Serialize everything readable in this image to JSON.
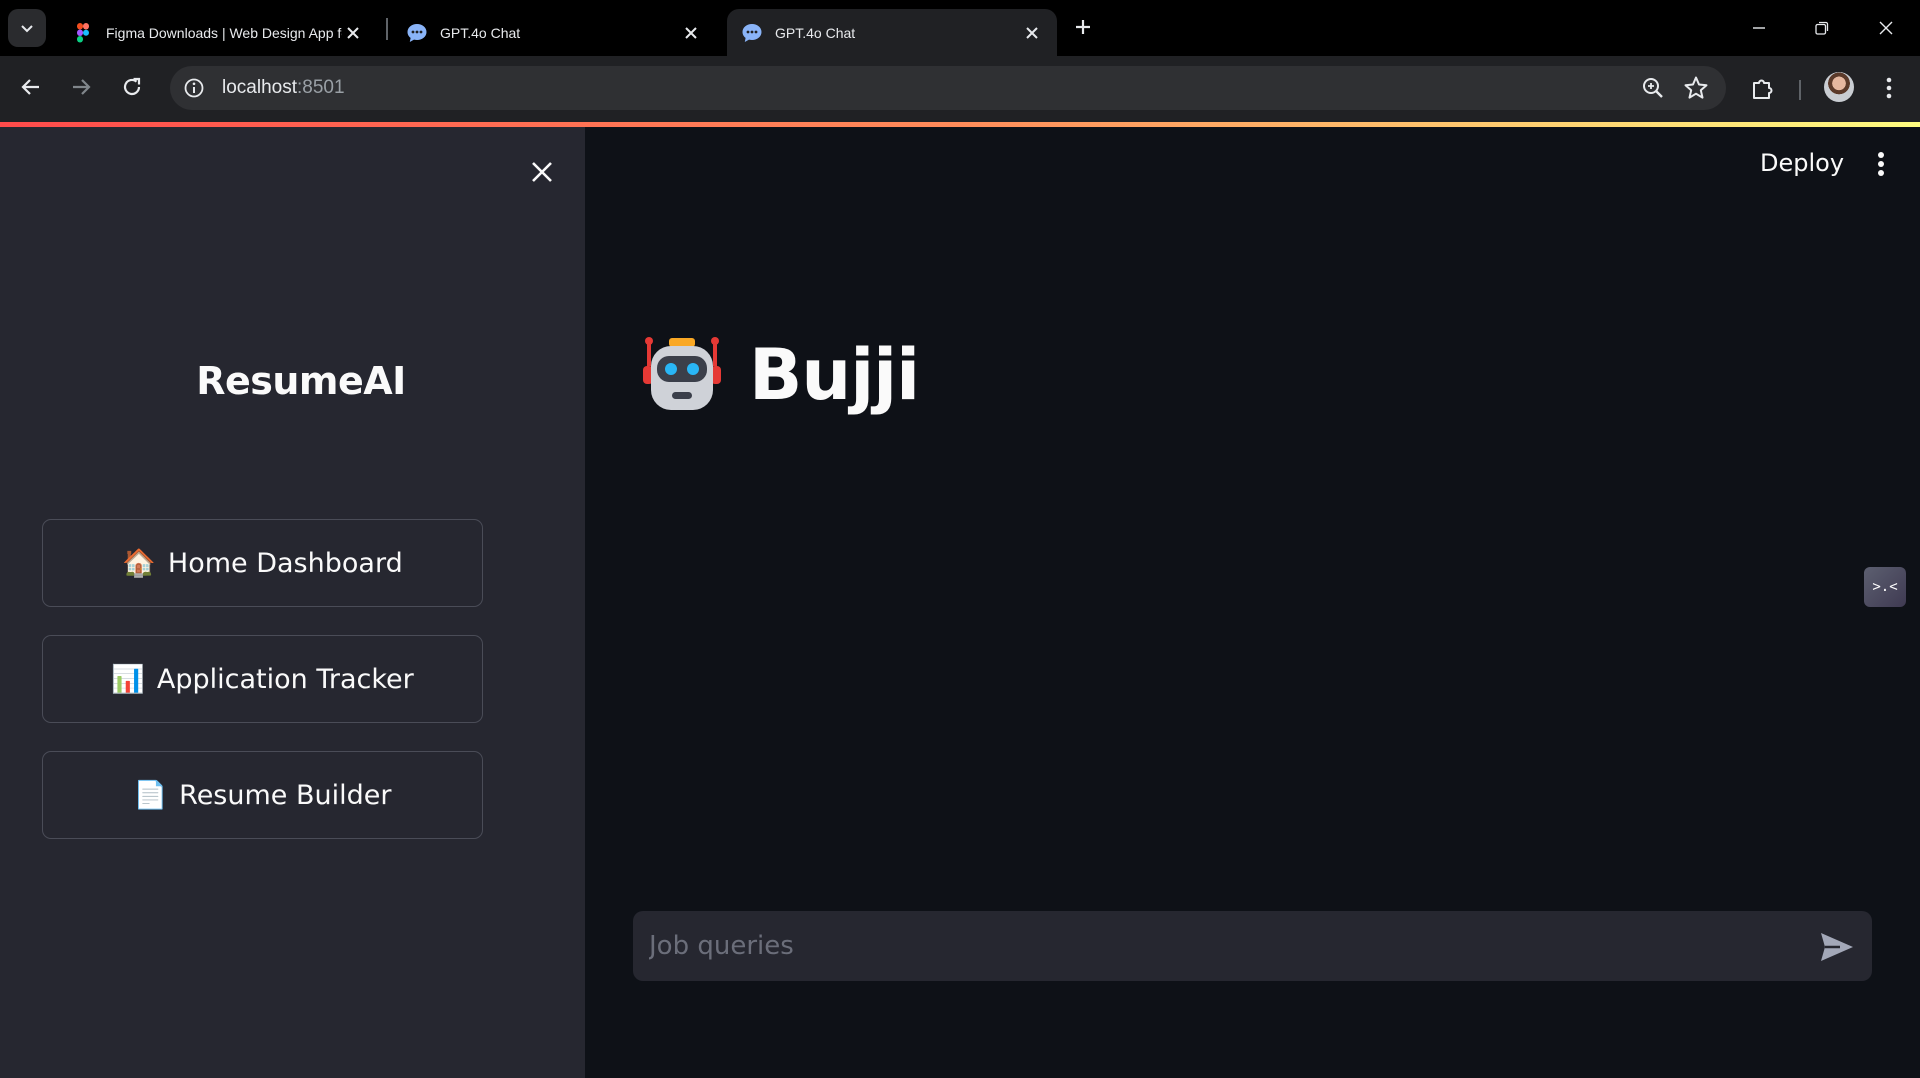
{
  "browser": {
    "tabs": [
      {
        "title": "Figma Downloads | Web Design App for D",
        "favicon": "figma-icon",
        "active": false
      },
      {
        "title": "GPT.4o Chat",
        "favicon": "chat-bubble-icon",
        "active": false
      },
      {
        "title": "GPT.4o Chat",
        "favicon": "chat-bubble-icon",
        "active": true
      }
    ],
    "url_host": "localhost",
    "url_port": ":8501",
    "accent": "#ff4b4b"
  },
  "sidebar": {
    "title": "ResumeAI",
    "nav": [
      {
        "emoji": "🏠",
        "label": "Home Dashboard"
      },
      {
        "emoji": "📊",
        "label": "Application Tracker"
      },
      {
        "emoji": "📄",
        "label": "Resume Builder"
      }
    ]
  },
  "header": {
    "deploy_label": "Deploy"
  },
  "main": {
    "title": "Bujji",
    "title_icon": "robot-icon",
    "widget_label": ">.<",
    "chat_placeholder": "Job queries"
  }
}
